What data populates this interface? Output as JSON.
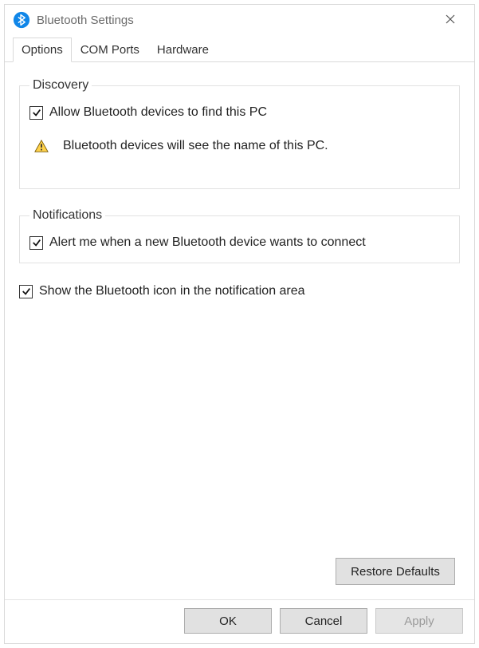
{
  "window": {
    "title": "Bluetooth Settings"
  },
  "tabs": {
    "options": "Options",
    "com_ports": "COM Ports",
    "hardware": "Hardware"
  },
  "discovery": {
    "legend": "Discovery",
    "allow_label": "Allow Bluetooth devices to find this PC",
    "info_text": "Bluetooth devices will see the name of this PC."
  },
  "notifications": {
    "legend": "Notifications",
    "alert_label": "Alert me when a new Bluetooth device wants to connect"
  },
  "show_icon_label": "Show the Bluetooth icon in the notification area",
  "buttons": {
    "restore_defaults": "Restore Defaults",
    "ok": "OK",
    "cancel": "Cancel",
    "apply": "Apply"
  }
}
